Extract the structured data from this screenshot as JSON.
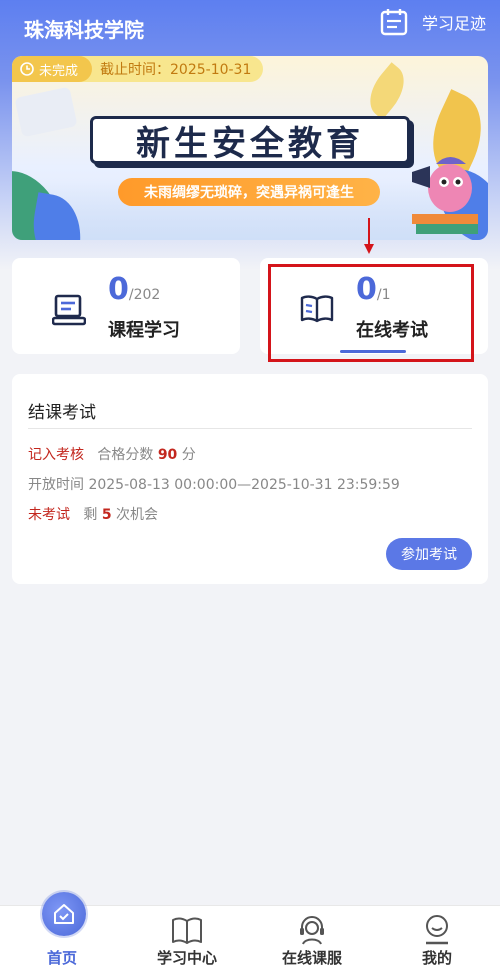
{
  "header": {
    "title": "珠海科技学院",
    "footprint_label": "学习足迹"
  },
  "banner": {
    "status": "未完成",
    "deadline": "截止时间：2025-10-31",
    "title": "新生安全教育",
    "slogan": "未雨绸缪无琐碎，突遇异祸可逢生"
  },
  "stats": [
    {
      "count": "0",
      "total": "/202",
      "label": "课程学习"
    },
    {
      "count": "0",
      "total": "/1",
      "label": "在线考试"
    }
  ],
  "exam": {
    "title": "结课考试",
    "record_label": "记入考核",
    "pass_prefix": "合格分数",
    "pass_score": "90",
    "pass_unit": "分",
    "open_time": "开放时间 2025-08-13 00:00:00—2025-10-31 23:59:59",
    "status": "未考试",
    "remain_prefix": "剩",
    "remain_count": "5",
    "remain_suffix": "次机会",
    "join_button": "参加考试"
  },
  "tabbar": [
    {
      "label": "首页",
      "icon": "home-icon",
      "active": true
    },
    {
      "label": "学习中心",
      "icon": "book-icon",
      "active": false
    },
    {
      "label": "在线课服",
      "icon": "headset-icon",
      "active": false
    },
    {
      "label": "我的",
      "icon": "profile-icon",
      "active": false
    }
  ],
  "colors": {
    "primary": "#4c69d9",
    "alert": "#c3271e",
    "highlight": "#d4141a"
  }
}
